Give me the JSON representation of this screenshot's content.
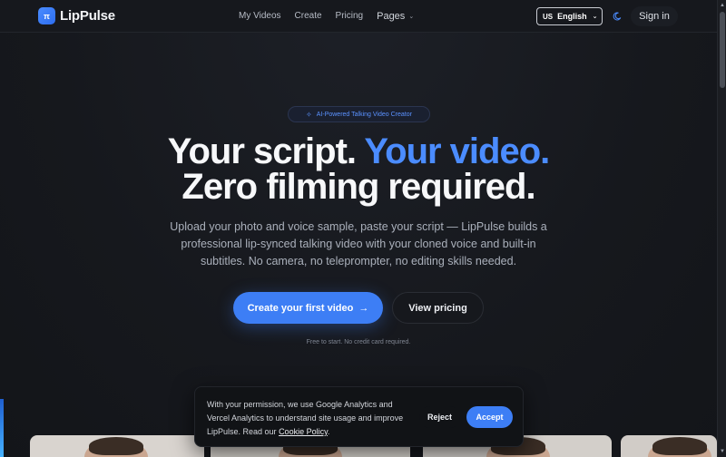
{
  "brand": {
    "name": "LipPulse",
    "logo_glyph": "π"
  },
  "nav": {
    "links": [
      "My Videos",
      "Create",
      "Pricing"
    ],
    "pages_label": "Pages",
    "language": {
      "flag": "US",
      "label": "English"
    },
    "theme_icon": "moon-icon",
    "signin_label": "Sign in"
  },
  "hero": {
    "badge": "AI-Powered Talking Video Creator",
    "headline_part1": "Your script. ",
    "headline_accent": "Your video.",
    "headline_line2": "Zero filming required.",
    "subtitle": "Upload your photo and voice sample, paste your script — LipPulse builds a professional lip-synced talking video with your cloned voice and built-in subtitles. No camera, no teleprompter, no editing skills needed.",
    "cta_label": "Create your first video",
    "cta_arrow": "→",
    "pricing_label": "View pricing",
    "fine_print": "Free to start. No credit card required."
  },
  "cookie": {
    "text": "With your permission, we use Google Analytics and Vercel Analytics to understand site usage and improve LipPulse. Read our ",
    "link": "Cookie Policy",
    "suffix": ".",
    "reject_label": "Reject",
    "accept_label": "Accept"
  },
  "colors": {
    "accent": "#3d7ef5",
    "headline_accent": "#4b8cff",
    "background": "#15171c"
  }
}
